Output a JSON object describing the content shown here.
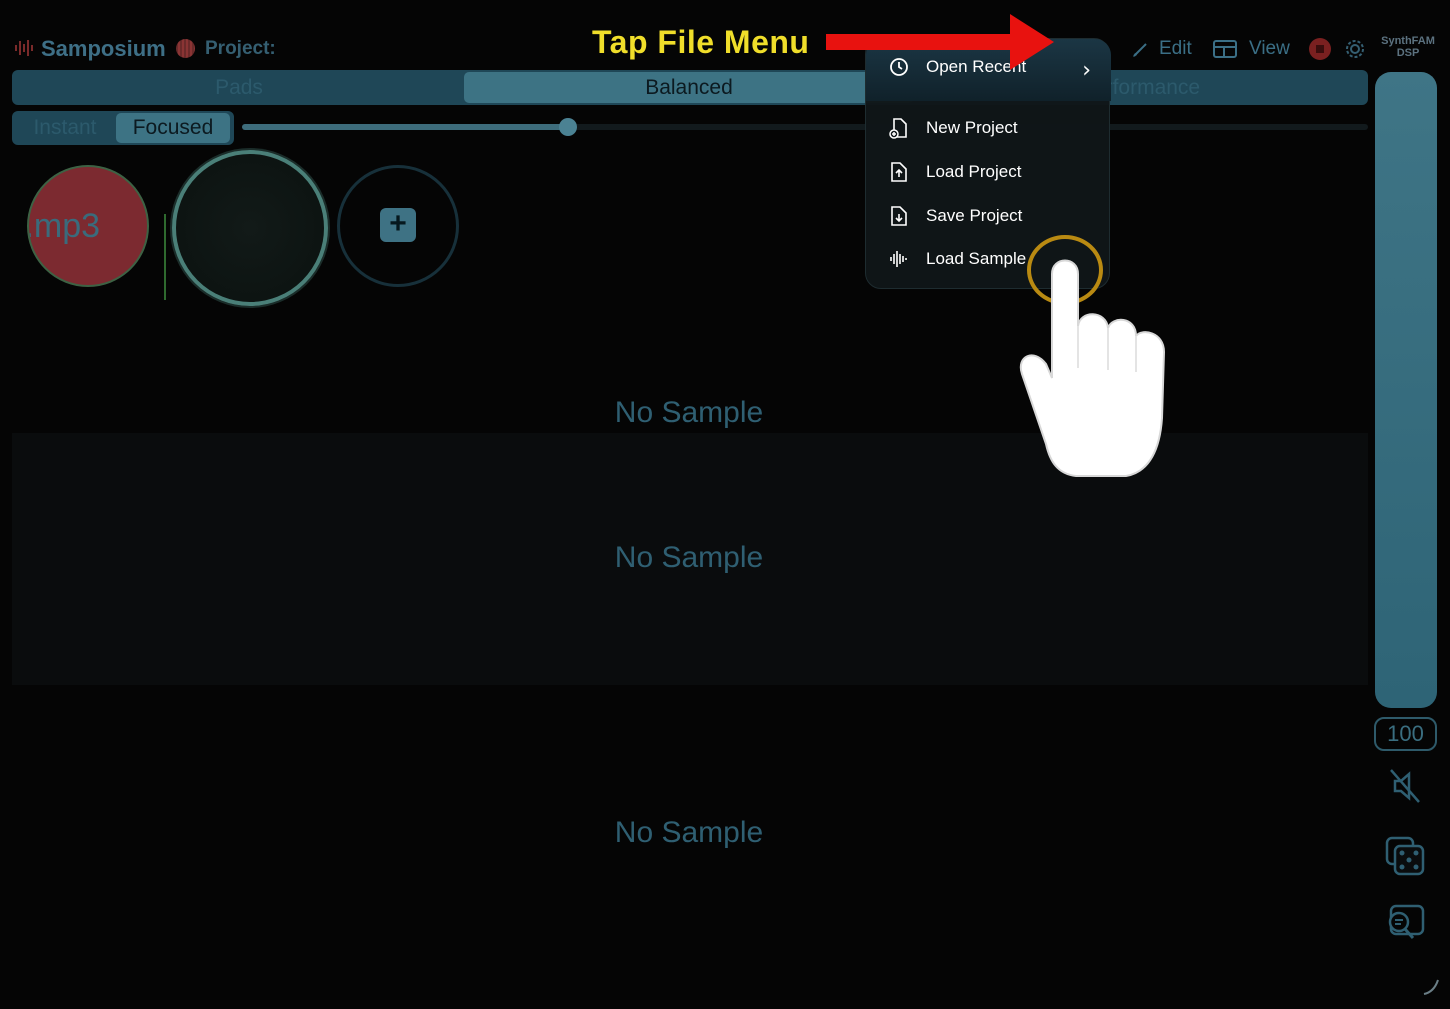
{
  "app": {
    "name": "Samposium",
    "project_label": "Project:",
    "brand_line1": "SynthFAM",
    "brand_line2": "DSP"
  },
  "toolbar": {
    "edit_label": "Edit",
    "view_label": "View"
  },
  "layout_tabs": [
    {
      "label": "Pads"
    },
    {
      "label": "Balanced"
    },
    {
      "label": "Performance",
      "visible_fragment": "formance"
    }
  ],
  "mode_tabs": [
    {
      "label": "Instant"
    },
    {
      "label": "Focused"
    }
  ],
  "pads": {
    "active_pad_label": "́.mp3",
    "active_pad_visible": ".mp3",
    "add_label": "+"
  },
  "tracks": [
    {
      "label": "No Sample"
    },
    {
      "label": "No Sample"
    },
    {
      "label": "No Sample"
    }
  ],
  "volume": {
    "value": "100",
    "level": 1.0
  },
  "file_menu": {
    "items": [
      {
        "label": "Open Recent",
        "icon": "clock-history-icon",
        "submenu": true
      },
      {
        "label": "New Project",
        "icon": "doc-plus-icon"
      },
      {
        "label": "Load Project",
        "icon": "doc-up-icon"
      },
      {
        "label": "Save Project",
        "icon": "doc-down-icon"
      },
      {
        "label": "Load Sample",
        "icon": "waveform-icon"
      }
    ]
  },
  "tutorial": {
    "caption": "Tap File Menu"
  },
  "colors": {
    "accent": "#3e7284",
    "record": "#7a2020",
    "caption": "#f0de2a",
    "arrow": "#e8120f"
  }
}
